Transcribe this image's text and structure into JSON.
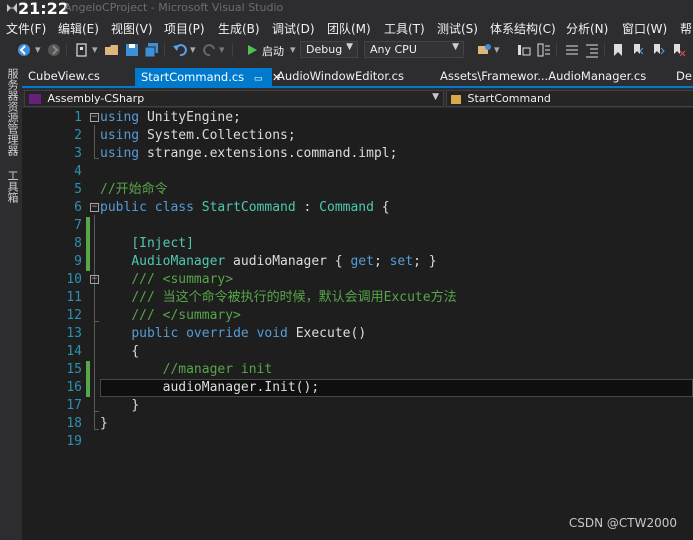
{
  "window": {
    "time": "21:22",
    "title": "AngeloCProject - Microsoft Visual Studio"
  },
  "menu": [
    "文件(F)",
    "编辑(E)",
    "视图(V)",
    "项目(P)",
    "生成(B)",
    "调试(D)",
    "团队(M)",
    "工具(T)",
    "测试(S)",
    "体系结构(C)",
    "分析(N)",
    "窗口(W)",
    "帮"
  ],
  "toolbar": {
    "start_label": "启动",
    "configuration": "Debug",
    "platform": "Any CPU"
  },
  "side_panel": {
    "items": [
      "服务器资源管理器",
      "工具箱"
    ]
  },
  "tabs": [
    {
      "label": "CubeView.cs"
    },
    {
      "label": "StartCommand.cs",
      "active": true
    },
    {
      "label": "AudioWindowEditor.cs"
    },
    {
      "label": "Assets\\Framewor...AudioManager.cs"
    },
    {
      "label": "De"
    }
  ],
  "navbar": {
    "project": "Assembly-CSharp",
    "type": "StartCommand"
  },
  "code": {
    "lines": [
      {
        "n": "1"
      },
      {
        "n": "2"
      },
      {
        "n": "3"
      },
      {
        "n": "4"
      },
      {
        "n": "5"
      },
      {
        "n": "6"
      },
      {
        "n": "7"
      },
      {
        "n": "8"
      },
      {
        "n": "9"
      },
      {
        "n": "10"
      },
      {
        "n": "11"
      },
      {
        "n": "12"
      },
      {
        "n": "13"
      },
      {
        "n": "14"
      },
      {
        "n": "15"
      },
      {
        "n": "16"
      },
      {
        "n": "17"
      },
      {
        "n": "18"
      },
      {
        "n": "19"
      }
    ],
    "tokens": {
      "using": "using",
      "unity_engine": " UnityEngine;",
      "system_collections": " System.Collections;",
      "strange_impl": " strange.extensions.command.impl;",
      "comment_start": "//开始命令",
      "public": "public",
      "class": "class",
      "start_command": "StartCommand",
      "colon": " : ",
      "command": "Command",
      "open_brace_sp": " {",
      "inject": "[Inject]",
      "audio_manager_type": "AudioManager",
      "audio_manager_field": " audioManager { ",
      "get": "get",
      "semi_sp": "; ",
      "set": "set",
      "close_prop": "; }",
      "summary_open": "/// <summary>",
      "summary_text": "/// 当这个命令被执行的时候，默认会调用Excute方法",
      "summary_close": "/// </summary>",
      "override": "override",
      "void": "void",
      "execute": " Execute()",
      "open_brace": "{",
      "manager_init_comment": "//manager init",
      "init_call": "audioManager.Init();",
      "close_brace": "}"
    }
  },
  "watermark": "CSDN @CTW2000"
}
